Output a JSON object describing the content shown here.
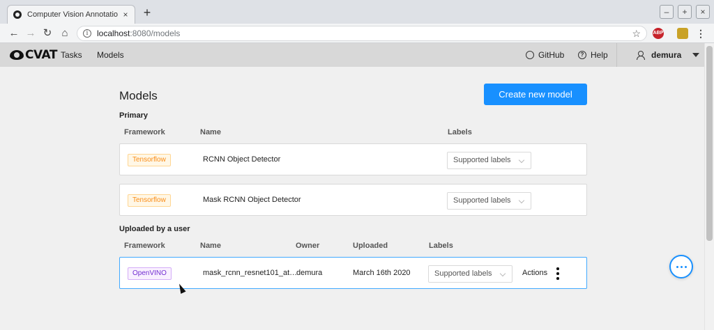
{
  "browser": {
    "tab_title": "Computer Vision Annotation To",
    "tab_close": "×",
    "new_tab": "+",
    "window_controls": [
      "–",
      "+",
      "×"
    ],
    "nav": {
      "back": "←",
      "forward": "→",
      "reload": "↻",
      "home": "⌂"
    },
    "url_host": "localhost",
    "url_path": ":8080/models",
    "extensions": [
      {
        "name": "abp-icon",
        "label": "ABP",
        "color": "#c6232b"
      },
      {
        "name": "avatar-icon",
        "label": "",
        "color": "#c9a227"
      }
    ]
  },
  "header": {
    "logo": "CVAT",
    "nav": [
      "Tasks",
      "Models"
    ],
    "github": "GitHub",
    "help": "Help",
    "user": "demura"
  },
  "main": {
    "title": "Models",
    "create_button": "Create new model",
    "primary": {
      "title": "Primary",
      "columns": [
        "Framework",
        "Name",
        "Labels"
      ],
      "rows": [
        {
          "framework": "Tensorflow",
          "name": "RCNN Object Detector",
          "labels": "Supported labels"
        },
        {
          "framework": "Tensorflow",
          "name": "Mask RCNN Object Detector",
          "labels": "Supported labels"
        }
      ]
    },
    "uploaded": {
      "title": "Uploaded by a user",
      "columns": [
        "Framework",
        "Name",
        "Owner",
        "Uploaded",
        "Labels"
      ],
      "rows": [
        {
          "framework": "OpenVINO",
          "name": "mask_rcnn_resnet101_at…",
          "owner": "demura",
          "uploaded": "March 16th 2020",
          "labels": "Supported labels",
          "actions": "Actions"
        }
      ]
    }
  },
  "colors": {
    "primary": "#1890ff",
    "tensorflow_tag": "#fa8c16",
    "openvino_tag": "#722ed1"
  }
}
